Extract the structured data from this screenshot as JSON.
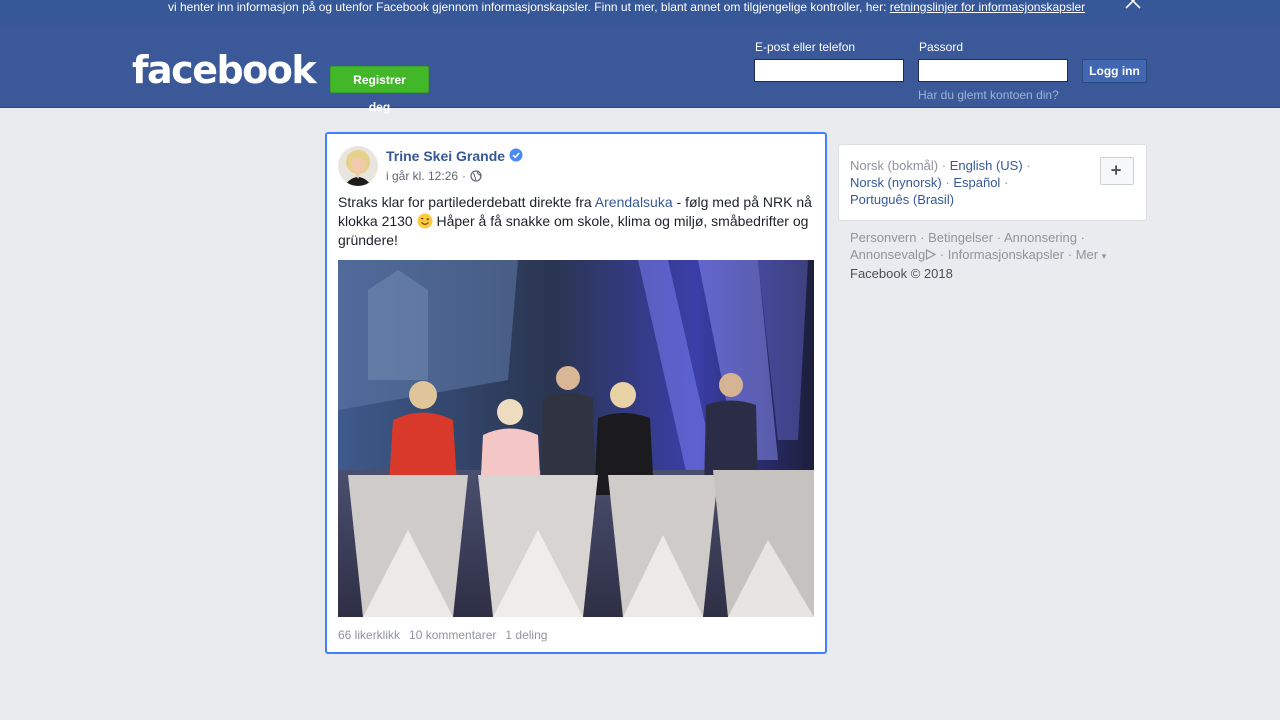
{
  "cookie_bar": {
    "text": "vi henter inn informasjon på og utenfor Facebook gjennom informasjonskapsler. Finn ut mer, blant annet om tilgjengelige kontroller, her:",
    "link": "retningslinjer for informasjonskapsler"
  },
  "header": {
    "logo": "facebook",
    "register_label": "Registrer deg",
    "email_label": "E-post eller telefon",
    "password_label": "Passord",
    "login_label": "Logg inn",
    "forgot_label": "Har du glemt kontoen din?"
  },
  "post": {
    "author": "Trine Skei Grande",
    "time": "i går kl. 12:26",
    "time_separator": "·",
    "text_before": "Straks klar for partilederdebatt direkte fra",
    "hashtag": "Arendalsuka",
    "text_middle": "- følg med på NRK nå klokka 2130",
    "text_after": "Håper å få snakke om skole, klima og miljø, småbedrifter og gründere!",
    "stats": {
      "likes": "66 likerklikk",
      "comments": "10 kommentarer",
      "shares": "1 deling"
    }
  },
  "languages": {
    "current": "Norsk (bokmål)",
    "options": [
      "English (US)",
      "Norsk (nynorsk)",
      "Español",
      "Português (Brasil)"
    ],
    "separator": "·",
    "more_icon": "plus-icon"
  },
  "footer": {
    "links": [
      "Personvern",
      "Betingelser",
      "Annonsering",
      "Annonsevalg",
      "Informasjonskapsler",
      "Mer"
    ],
    "more_caret": "▾",
    "separator": "·",
    "copyright": "Facebook © 2018"
  },
  "colors": {
    "brand_blue": "#3b5998",
    "cookie_bar": "#365899",
    "register_green": "#42b72a",
    "link_blue": "#365899",
    "focus_border": "#4080ff"
  }
}
